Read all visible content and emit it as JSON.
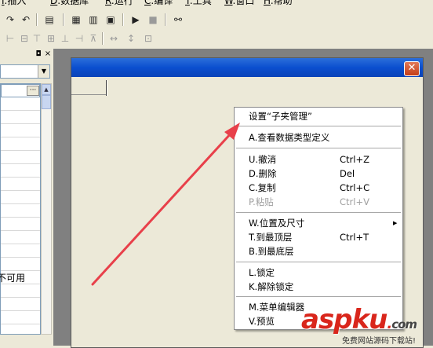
{
  "menubar": {
    "items": [
      {
        "accel": "I",
        "label": ".插入"
      },
      {
        "accel": "D",
        "label": ".数据库"
      },
      {
        "accel": "R",
        "label": ".运行"
      },
      {
        "accel": "C",
        "label": ".编译"
      },
      {
        "accel": "T",
        "label": ".工具"
      },
      {
        "accel": "W",
        "label": ".窗口"
      },
      {
        "accel": "H",
        "label": ".帮助"
      }
    ]
  },
  "left_panel": {
    "unavailable_text": "不可用",
    "ellipsis": "···"
  },
  "context_menu": {
    "items": [
      {
        "label": "设置“子夹管理”",
        "shortcut": ""
      },
      {
        "label": "A.查看数据类型定义",
        "shortcut": ""
      },
      {
        "label": "U.撤消",
        "shortcut": "Ctrl+Z"
      },
      {
        "label": "D.删除",
        "shortcut": "Del"
      },
      {
        "label": "C.复制",
        "shortcut": "Ctrl+C"
      },
      {
        "label": "P.粘贴",
        "shortcut": "Ctrl+V"
      },
      {
        "label": "W.位置及尺寸",
        "shortcut": ""
      },
      {
        "label": "T.到最顶层",
        "shortcut": "Ctrl+T"
      },
      {
        "label": "B.到最底层",
        "shortcut": ""
      },
      {
        "label": "L.锁定",
        "shortcut": ""
      },
      {
        "label": "K.解除锁定",
        "shortcut": ""
      },
      {
        "label": "M.菜单编辑器",
        "shortcut": ""
      },
      {
        "label": "V.预览",
        "shortcut": ""
      }
    ]
  },
  "watermark": {
    "brand": "aspku",
    "dot": ".",
    "tld": "com",
    "slogan": "免费网站源码下载站!"
  },
  "colors": {
    "arrow": "#e8404a",
    "titlebar": "#0b4fcf",
    "close_button": "#c53d17",
    "watermark": "#d9261c"
  }
}
